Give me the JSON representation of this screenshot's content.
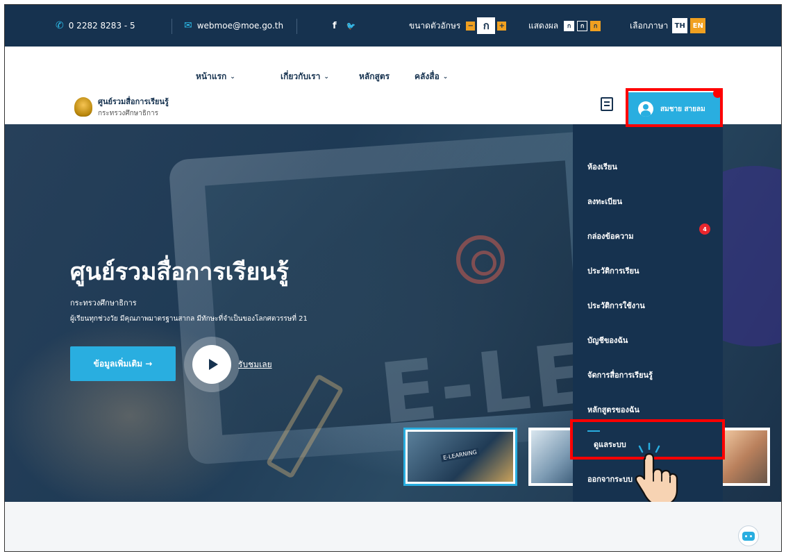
{
  "topbar": {
    "phone": "0 2282 8283 - 5",
    "email": "webmoe@moe.go.th",
    "facebook_glyph": "f",
    "twitter_glyph": "🐦",
    "font_size_label": "ขนาดตัวอักษร",
    "font_minus": "−",
    "font_mid": "ก",
    "font_plus": "+",
    "display_label": "แสดงผล",
    "display_white": "ก",
    "display_dark": "ก",
    "display_yellow": "ก",
    "language_label": "เลือกภาษา",
    "lang_th": "TH",
    "lang_en": "EN"
  },
  "header": {
    "nav": [
      {
        "label": "หน้าแรก",
        "has_dropdown": true
      },
      {
        "label": "เกี่ยวกับเรา",
        "has_dropdown": true
      },
      {
        "label": "หลักสูตร",
        "has_dropdown": false
      },
      {
        "label": "คลังสื่อ",
        "has_dropdown": true
      }
    ],
    "logo_title": "ศูนย์รวมสื่อการเรียนรู้",
    "logo_subtitle": "กระทรวงศึกษาธิการ",
    "user_name": "สมชาย สายลม"
  },
  "hero": {
    "title": "ศูนย์รวมสื่อการเรียนรู้",
    "subtitle": "กระทรวงศึกษาธิการ",
    "description": "ผู้เรียนทุกช่วงวัย มีคุณภาพมาตรฐานสากล มีทักษะที่จำเป็นของโลกศตวรรษที่ 21",
    "cta_label": "ข้อมูลเพิ่มเติม →",
    "watch_label": "รับชมเลย",
    "banner_text": "E-LEA"
  },
  "user_menu": {
    "items": [
      "ห้องเรียน",
      "ลงทะเบียน",
      "กล่องข้อความ",
      "ประวัติการเรียน",
      "ประวัติการใช้งาน",
      "บัญชีของฉัน",
      "จัดการสื่อการเรียนรู้",
      "หลักสูตรของฉัน",
      "ดูแลระบบ",
      "ออกจากระบบ"
    ],
    "message_count": "4",
    "active_item": "ดูแลระบบ"
  },
  "colors": {
    "navy": "#16324f",
    "accent_blue": "#29aee0",
    "accent_orange": "#f0a020",
    "highlight_red": "#ff0000",
    "badge_red": "#e8262d"
  },
  "icons": [
    "phone-icon",
    "email-icon",
    "facebook-icon",
    "twitter-icon",
    "chevron-down-icon",
    "book-icon",
    "user-avatar-icon",
    "play-icon",
    "hand-cursor-icon",
    "chatbot-icon"
  ]
}
